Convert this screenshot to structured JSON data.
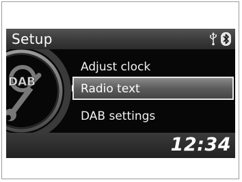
{
  "header": {
    "title": "Setup",
    "icons": [
      "usb-icon",
      "bluetooth-icon"
    ]
  },
  "category": {
    "badge_text": "DAB",
    "icon": "wrench-icon"
  },
  "menu": {
    "items": [
      {
        "label": "Adjust clock",
        "selected": false
      },
      {
        "label": "Radio text",
        "selected": true
      },
      {
        "label": "DAB settings",
        "selected": false
      }
    ]
  },
  "status": {
    "clock": "12:34"
  },
  "colors": {
    "screen_background": "#070707",
    "highlight": "#6a6a6a",
    "text": "#ffffff"
  }
}
